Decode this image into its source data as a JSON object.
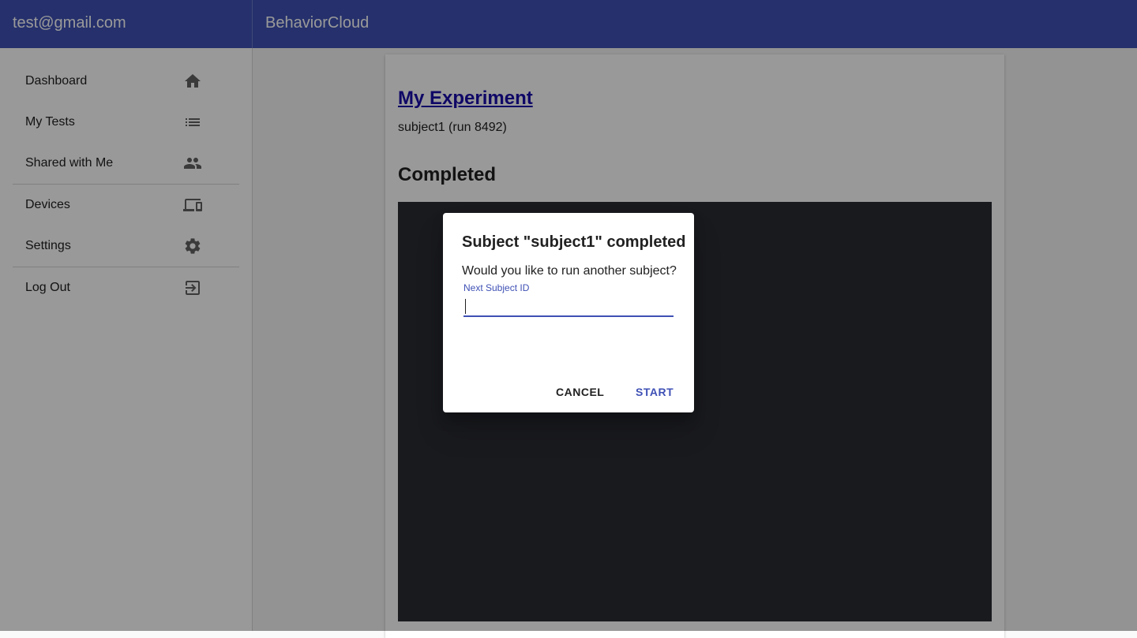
{
  "header": {
    "user_email": "test@gmail.com",
    "app_title": "BehaviorCloud"
  },
  "sidebar": {
    "items": [
      {
        "label": "Dashboard",
        "icon": "home-icon"
      },
      {
        "label": "My Tests",
        "icon": "list-icon"
      },
      {
        "label": "Shared with Me",
        "icon": "people-icon"
      },
      {
        "label": "Devices",
        "icon": "devices-icon"
      },
      {
        "label": "Settings",
        "icon": "gear-icon"
      },
      {
        "label": "Log Out",
        "icon": "logout-icon"
      }
    ]
  },
  "main": {
    "experiment_title": "My Experiment",
    "run_info": "subject1 (run 8492)",
    "status": "Completed"
  },
  "dialog": {
    "title": "Subject \"subject1\" completed",
    "message": "Would you like to run another subject?",
    "field_label": "Next Subject ID",
    "field_value": "",
    "cancel_label": "CANCEL",
    "start_label": "START"
  },
  "colors": {
    "primary": "#3f51b5",
    "link": "#1a0dab"
  }
}
